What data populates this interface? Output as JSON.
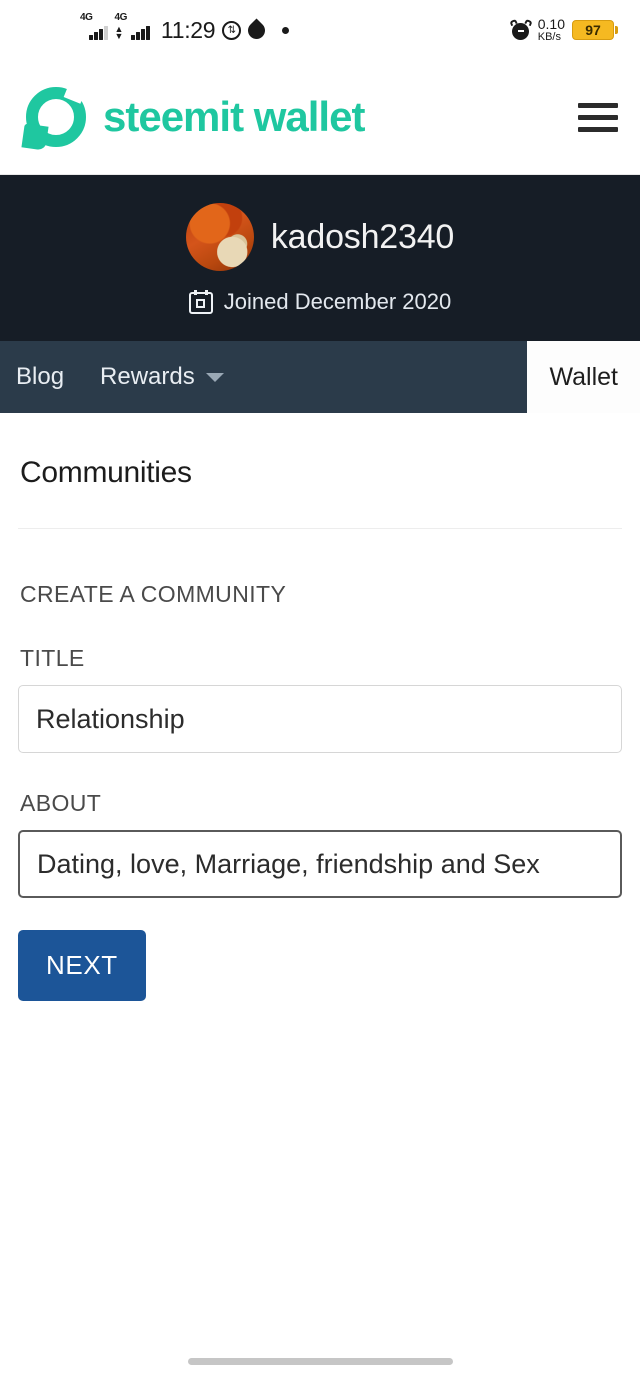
{
  "statusbar": {
    "network_type_1": "4G",
    "network_type_2": "4G",
    "time": "11:29",
    "sync_icon": "sync-circle-icon",
    "drop_icon": "water-drop-icon",
    "dot_icon": "dot-icon",
    "alarm_icon": "alarm-clock-icon",
    "net_speed_value": "0.10",
    "net_speed_unit": "KB/s",
    "battery_level": "97"
  },
  "header": {
    "brand": "steemit wallet",
    "logo_icon": "steemit-logo-icon",
    "menu_icon": "hamburger-menu-icon",
    "brand_color": "#1fc7a0"
  },
  "profile": {
    "username": "kadosh2340",
    "avatar_icon": "user-avatar",
    "calendar_icon": "calendar-icon",
    "joined": "Joined December 2020",
    "background_color": "#161d26"
  },
  "tabs": [
    {
      "label": "Blog",
      "active": false,
      "has_caret": false
    },
    {
      "label": "Rewards",
      "active": false,
      "has_caret": true,
      "caret_icon": "chevron-down-icon"
    },
    {
      "label": "Wallet",
      "active": true,
      "has_caret": false
    }
  ],
  "main": {
    "page_title": "Communities",
    "section_label": "CREATE A COMMUNITY",
    "title_field": {
      "label": "TITLE",
      "value": "Relationship",
      "placeholder": ""
    },
    "about_field": {
      "label": "ABOUT",
      "value": "Dating, love, Marriage, friendship and Sex",
      "placeholder": ""
    },
    "next_button": "NEXT",
    "next_button_color": "#1c5598"
  },
  "system": {
    "home_indicator": "home-indicator"
  }
}
